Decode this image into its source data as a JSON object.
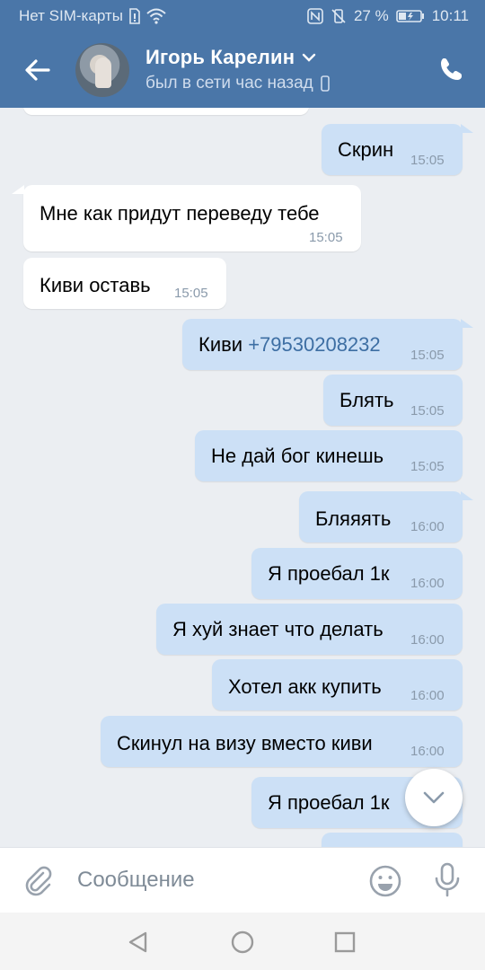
{
  "status_bar": {
    "carrier": "Нет SIM-карты",
    "battery": "27 %",
    "time": "10:11"
  },
  "header": {
    "contact_name": "Игорь Карелин",
    "last_seen": "был в сети час назад"
  },
  "messages": [
    {
      "side": "out",
      "text": "Скрин",
      "time": "15:05"
    },
    {
      "side": "in",
      "text": "Мне как придут переведу тебе",
      "time": "15:05"
    },
    {
      "side": "in",
      "text": "Киви оставь",
      "time": "15:05"
    },
    {
      "side": "out",
      "text": "Киви ",
      "link": "+79530208232",
      "time": "15:05"
    },
    {
      "side": "out",
      "text": "Блять",
      "time": "15:05"
    },
    {
      "side": "out",
      "text": "Не дай бог кинешь",
      "time": "15:05"
    },
    {
      "side": "out",
      "text": "Бляяять",
      "time": "16:00"
    },
    {
      "side": "out",
      "text": "Я проебал 1к",
      "time": "16:00"
    },
    {
      "side": "out",
      "text": "Я хуй знает что делать",
      "time": "16:00"
    },
    {
      "side": "out",
      "text": "Хотел акк купить",
      "time": "16:00"
    },
    {
      "side": "out",
      "text": "Скинул на визу вместо киви",
      "time": "16:00"
    },
    {
      "side": "out",
      "text": "Я проебал 1к",
      "time": ""
    }
  ],
  "composer": {
    "placeholder": "Сообщение"
  },
  "colors": {
    "header": "#4a76a8",
    "outgoing_bubble": "#cce0f6",
    "incoming_bubble": "#ffffff",
    "chat_background": "#ebeef2"
  }
}
